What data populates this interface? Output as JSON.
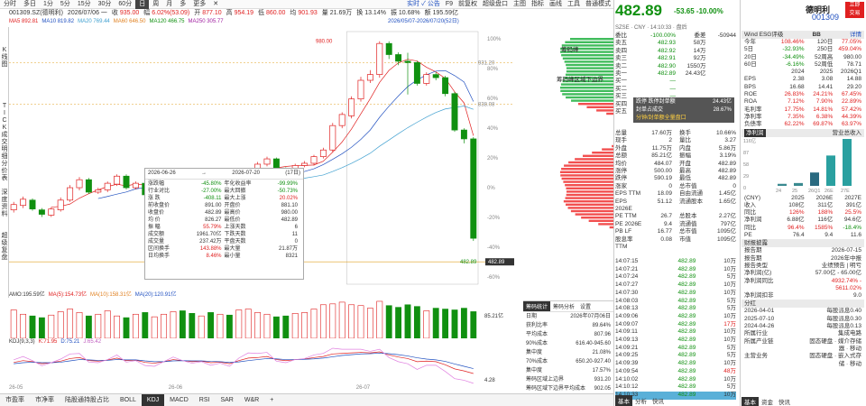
{
  "toolbar": {
    "items": [
      "分时",
      "多日",
      "1分",
      "5分",
      "15分",
      "30分",
      "60分",
      "日",
      "周",
      "月",
      "多",
      "更多",
      "✕"
    ],
    "active": 7,
    "right": [
      "实时 ✓ 公告",
      "F9",
      "前复权",
      "超级盘口",
      "主图",
      "指标",
      "画线",
      "工具",
      "",
      "普通模式"
    ]
  },
  "stock": {
    "code": "001309.SZ(德明利)",
    "date": "2026/07/06",
    "day": "一",
    "close_label": "收",
    "close": "935.00",
    "chg_label": "幅",
    "chg": "6.02%(53.09)",
    "open_label": "开",
    "open": "877.10",
    "high_label": "高",
    "high": "954.19",
    "low_label": "低",
    "low": "860.00",
    "cur_label": "均",
    "cur": "901.93",
    "vol_label": "量",
    "vol": "21.69万",
    "turn_label": "换",
    "turn": "13.14%",
    "amp_label": "振",
    "amp": "10.68%",
    "amt_label": "额",
    "amt": "195.59亿"
  },
  "ma": [
    {
      "label": "MA5",
      "value": "892.81",
      "color": "#e02020"
    },
    {
      "label": "MA10",
      "value": "819.82",
      "color": "#2050c0"
    },
    {
      "label": "MA20",
      "value": "769.44",
      "color": "#40a0d0"
    },
    {
      "label": "MA60",
      "value": "646.50",
      "color": "#e08020"
    },
    {
      "label": "MA120",
      "value": "466.75",
      "color": "#109010"
    },
    {
      "label": "MA250",
      "value": "305.77",
      "color": "#a020a0"
    }
  ],
  "date_range": "2026/05/07-2026/07/20(52日)",
  "vert_tabs": [
    {
      "text": "K\n线\n图",
      "y": 22
    },
    {
      "text": "T\nI\nC\nK\n成\n交\n明\n细",
      "y": 84
    },
    {
      "text": "分\n价\n表",
      "y": 148
    },
    {
      "text": "深\n度\n资\n料",
      "y": 180
    },
    {
      "text": "超\n级\n复\n盘",
      "y": 228
    }
  ],
  "y_labels": [
    "1012",
    "986",
    "959",
    "933",
    "906",
    "880",
    "855",
    "826",
    "800",
    "773",
    "747",
    "720",
    "693",
    "667",
    "640",
    "614",
    "587",
    "561",
    "534",
    "508",
    "481",
    "455",
    "429",
    "402"
  ],
  "pct_labels": [
    "100%",
    "80%",
    "60%",
    "40%",
    "20%",
    "0%",
    "-20%",
    "-40%",
    "-60%"
  ],
  "price_tags": {
    "top": "980.00",
    "right_top": "931.20",
    "mid": "838.08",
    "low": "482.89",
    "low2": "482.89"
  },
  "dist_labels": {
    "a": "筹码峰",
    "b": "筹码峰区域下边界"
  },
  "chart_data": [
    {
      "type": "candlestick",
      "title": "",
      "xlabel": "",
      "ylabel": "",
      "x": [
        "05-07",
        "05-08",
        "05-11",
        "05-12",
        "05-13",
        "05-14",
        "05-15",
        "05-18",
        "05-19",
        "05-20",
        "05-21",
        "05-22",
        "05-25",
        "05-26",
        "05-27",
        "05-28",
        "05-29",
        "06-01",
        "06-02",
        "06-03",
        "06-04",
        "06-05",
        "06-08",
        "06-09",
        "06-10",
        "06-11",
        "06-12",
        "06-15",
        "06-16",
        "06-17",
        "06-18",
        "06-19",
        "06-22",
        "06-23",
        "06-24",
        "06-25",
        "06-26",
        "06-29",
        "06-30",
        "07-01",
        "07-02",
        "07-03",
        "07-06",
        "07-07",
        "07-08",
        "07-09",
        "07-10",
        "07-13",
        "07-14",
        "07-15"
      ],
      "open": [
        600,
        610,
        622,
        600,
        588,
        600,
        622,
        650,
        668,
        640,
        645,
        658,
        676,
        650,
        660,
        634,
        640,
        655,
        672,
        668,
        660,
        668,
        652,
        660,
        640,
        672,
        690,
        703,
        715,
        693,
        688,
        700,
        705,
        720,
        735,
        790,
        812,
        850,
        892,
        905,
        975,
        950,
        935,
        932,
        885,
        905,
        898,
        862,
        780,
        760
      ],
      "close": [
        612,
        624,
        602,
        590,
        602,
        622,
        650,
        668,
        640,
        645,
        660,
        676,
        650,
        660,
        634,
        642,
        656,
        672,
        668,
        660,
        668,
        652,
        660,
        640,
        672,
        690,
        703,
        715,
        693,
        688,
        700,
        705,
        720,
        735,
        790,
        815,
        850,
        892,
        905,
        975,
        950,
        935,
        932,
        885,
        905,
        898,
        862,
        780,
        760,
        536
      ],
      "high": [
        618,
        630,
        626,
        604,
        606,
        628,
        656,
        674,
        672,
        650,
        664,
        680,
        680,
        664,
        664,
        648,
        660,
        676,
        676,
        672,
        672,
        670,
        664,
        662,
        676,
        694,
        708,
        720,
        718,
        696,
        704,
        710,
        724,
        740,
        796,
        820,
        856,
        900,
        915,
        980,
        980,
        955,
        954,
        936,
        910,
        910,
        902,
        866,
        784,
        764
      ],
      "low": [
        594,
        604,
        598,
        584,
        584,
        596,
        618,
        644,
        636,
        636,
        640,
        654,
        646,
        646,
        630,
        628,
        636,
        650,
        660,
        654,
        654,
        646,
        646,
        636,
        636,
        668,
        686,
        698,
        690,
        684,
        684,
        696,
        700,
        716,
        730,
        784,
        806,
        844,
        886,
        898,
        940,
        926,
        860,
        880,
        880,
        892,
        856,
        776,
        750,
        530
      ],
      "ylim": [
        402,
        1012
      ]
    },
    {
      "type": "bar",
      "title": "AMO",
      "values": [
        165,
        140,
        130,
        120,
        135,
        155,
        170,
        150,
        130,
        140,
        160,
        130,
        120,
        140,
        150,
        125,
        140,
        155,
        160,
        145,
        130,
        150,
        140,
        135,
        165,
        170,
        150,
        140,
        125,
        130,
        145,
        150,
        170,
        195,
        200,
        210,
        195,
        190,
        175,
        215,
        190,
        180,
        195,
        185,
        160,
        175,
        170,
        165,
        175,
        155
      ],
      "ylim": [
        0,
        220
      ],
      "info": [
        {
          "label": "AMO:",
          "value": "195.59亿"
        },
        {
          "label": "MA(5):",
          "value": "154.73亿"
        },
        {
          "label": "MA(10):",
          "value": "158.31亿"
        },
        {
          "label": "MA(20):",
          "value": "120.91亿"
        }
      ],
      "right": "85.21亿"
    },
    {
      "type": "line",
      "title": "KDJ(9,3,3)",
      "series": [
        {
          "name": "K",
          "color": "#e02020",
          "values": [
            55,
            62,
            58,
            50,
            54,
            60,
            70,
            74,
            62,
            60,
            64,
            72,
            62,
            64,
            55,
            52,
            58,
            66,
            62,
            58,
            60,
            54,
            56,
            50,
            62,
            72,
            74,
            78,
            66,
            62,
            66,
            68,
            74,
            78,
            88,
            90,
            92,
            94,
            92,
            96,
            84,
            76,
            70,
            58,
            60,
            58,
            46,
            30,
            22,
            12
          ]
        },
        {
          "name": "D",
          "color": "#2050c0",
          "values": [
            50,
            54,
            56,
            54,
            54,
            56,
            61,
            66,
            65,
            63,
            63,
            66,
            65,
            65,
            61,
            58,
            58,
            61,
            62,
            61,
            61,
            59,
            58,
            55,
            57,
            62,
            66,
            70,
            69,
            66,
            66,
            67,
            69,
            72,
            77,
            82,
            85,
            88,
            89,
            91,
            89,
            85,
            80,
            73,
            68,
            65,
            59,
            49,
            40,
            31
          ]
        },
        {
          "name": "J",
          "color": "#e080e0",
          "values": [
            65,
            78,
            62,
            42,
            54,
            68,
            88,
            90,
            56,
            54,
            66,
            84,
            56,
            62,
            43,
            40,
            58,
            76,
            62,
            52,
            58,
            44,
            52,
            40,
            72,
            92,
            90,
            94,
            60,
            54,
            66,
            70,
            84,
            90,
            110,
            106,
            106,
            106,
            98,
            106,
            74,
            58,
            50,
            28,
            44,
            44,
            20,
            -8,
            -14,
            -26
          ]
        }
      ],
      "ylim": [
        -30,
        110
      ],
      "info": [
        {
          "label": "KDJ(9,3,3)",
          "value": "K:",
          "vk": "71.95"
        },
        {
          "label": "D:",
          "value": "75.21"
        },
        {
          "label": "J:",
          "value": "65.42"
        }
      ],
      "right": "4.28"
    }
  ],
  "x_ticks": [
    {
      "label": "26-05",
      "pos": 0
    },
    {
      "label": "26-06",
      "pos": 17
    },
    {
      "label": "26-07",
      "pos": 37
    }
  ],
  "popup": {
    "from": "2026-06-26",
    "to": "2026-07-20",
    "days": "(17日)",
    "rows": [
      [
        "涨跌幅",
        "-45.80%",
        "年化收益率",
        "-99.99%"
      ],
      [
        "行业对比",
        "-27.00%",
        "最大回撤",
        "-50.73%"
      ],
      [
        "涨 跌",
        "-408.11",
        "最大上涨",
        "20.02%"
      ],
      [
        "前收盘价",
        "891.00",
        "开盘价",
        "881.10"
      ],
      [
        "收盘价",
        "482.89",
        "最高价",
        "980.00"
      ],
      [
        "均 价",
        "826.27",
        "最低价",
        "482.89"
      ],
      [
        "振 幅",
        "55.79%",
        "上涨天数",
        "6"
      ],
      [
        "成交额",
        "1961.70亿",
        "下跌天数",
        "11"
      ],
      [
        "成交量",
        "237.42万",
        "平盘天数",
        "0"
      ],
      [
        "区间换手",
        "143.88%",
        "最大量",
        "21.87万"
      ],
      [
        "日均换手",
        "8.46%",
        "最小量",
        "8321"
      ]
    ]
  },
  "chips": {
    "tabs": [
      "筹码统计",
      "筹码分析",
      "设置"
    ],
    "rows": [
      [
        "日期",
        "2026年07月06日"
      ],
      [
        "获利比率",
        "89.64%"
      ],
      [
        "平均成本",
        "807.96"
      ],
      [
        "90%成本",
        "616.40-945.60"
      ],
      [
        "集中度",
        "21.08%"
      ],
      [
        "70%成本",
        "650.20-927.40"
      ],
      [
        "集中度",
        "17.57%"
      ],
      [
        "筹码区域上边界",
        "931.20"
      ],
      [
        "筹码区域下边界平均成本",
        "902.05"
      ]
    ]
  },
  "bottom_tabs": [
    "市盈率",
    "市净率",
    "陆股通持股占比",
    "BOLL",
    "KDJ",
    "MACD",
    "RSI",
    "SAR",
    "W&R",
    "+"
  ],
  "bottom_active": 4,
  "quote": {
    "price": "482.89",
    "chg": "-53.65",
    "pct": "-10.00%",
    "code_line": "SZSE · CNY · 14:10:33 · 盘后",
    "name": "德明利",
    "code": "001309",
    "btn": "立即\n交易"
  },
  "orderbook": [
    [
      "委比",
      "-100.00%",
      "委差",
      "-50944"
    ],
    [
      "卖五",
      "482.93",
      "58万",
      ""
    ],
    [
      "卖四",
      "482.92",
      "14万",
      ""
    ],
    [
      "卖三",
      "482.91",
      "92万",
      ""
    ],
    [
      "卖二",
      "482.90",
      "1550万",
      ""
    ],
    [
      "卖一",
      "482.89",
      "24.43亿",
      ""
    ],
    [
      "买一",
      "—",
      "",
      ""
    ],
    [
      "买二",
      "—",
      "",
      ""
    ],
    [
      "买三",
      "—",
      "",
      ""
    ],
    [
      "买四",
      "—",
      "",
      ""
    ],
    [
      "买五",
      "—",
      "",
      ""
    ]
  ],
  "seal": {
    "l1": "跌停 跌停封单额",
    "v1": "24.43亿",
    "l2": "封单占成交",
    "v2": "28.67%",
    "l3": "分钟/封单额全量盘口"
  },
  "stats": [
    [
      "总量",
      "17.60万",
      "换手",
      "10.66%"
    ],
    [
      "现手",
      "2",
      "量比",
      "3.27"
    ],
    [
      "外盘",
      "11.75万",
      "内盘",
      "5.86万"
    ],
    [
      "总额",
      "85.21亿",
      "振幅",
      "3.19%"
    ],
    [
      "均价",
      "484.07",
      "开盘",
      "482.89"
    ],
    [
      "涨停",
      "500.00",
      "最高",
      "482.89"
    ],
    [
      "跌停",
      "590.19",
      "最低",
      "482.89"
    ],
    [
      "涨家",
      "0",
      "总市值",
      "0"
    ],
    [
      "EPS TTM",
      "18.09",
      "自由流通",
      "1.45亿"
    ],
    [
      "EPS 2026E",
      "51.12",
      "流通股本",
      "1.65亿"
    ],
    [
      "PE TTM",
      "26.7",
      "总股本",
      "2.27亿"
    ],
    [
      "PE 2026E",
      "9.4",
      "流通值",
      "797亿"
    ],
    [
      "PB LF",
      "16.77",
      "总市值",
      "1095亿"
    ],
    [
      "股息率 TTM",
      "0.08",
      "市值",
      "1095亿"
    ]
  ],
  "ticks": [
    [
      "14:07:15",
      "482.89",
      "10万"
    ],
    [
      "14:07:21",
      "482.89",
      "10万"
    ],
    [
      "14:07:24",
      "482.89",
      "5万"
    ],
    [
      "14:07:27",
      "482.89",
      "10万"
    ],
    [
      "14:07:30",
      "482.89",
      "10万"
    ],
    [
      "14:08:03",
      "482.89",
      "5万"
    ],
    [
      "14:08:13",
      "482.89",
      "5万"
    ],
    [
      "14:09:06",
      "482.89",
      "10万"
    ],
    [
      "14:09:07",
      "482.89",
      "17万"
    ],
    [
      "14:09:11",
      "482.89",
      "10万"
    ],
    [
      "14:09:13",
      "482.89",
      "10万"
    ],
    [
      "14:09:21",
      "482.89",
      "5万"
    ],
    [
      "14:09:25",
      "482.89",
      "5万"
    ],
    [
      "14:09:39",
      "482.89",
      "10万"
    ],
    [
      "14:09:54",
      "482.89",
      "48万"
    ],
    [
      "14:10:02",
      "482.89",
      "10万"
    ],
    [
      "14:10:12",
      "482.89",
      "5万"
    ],
    [
      "14:10:33",
      "482.89",
      "10万"
    ]
  ],
  "right_tabs": [
    "基本",
    "分析",
    "快讯"
  ],
  "fin": {
    "tab": "Wind ESG评级",
    "rating": "BB",
    "more": "详情",
    "perf": [
      [
        "今年",
        "108.46%",
        "120日",
        "77.05%"
      ],
      [
        "5日",
        "-32.93%",
        "250日",
        "459.04%"
      ],
      [
        "20日",
        "-34.49%",
        "52周高",
        "980.00"
      ],
      [
        "60日",
        "-6.16%",
        "52周低",
        "78.71"
      ]
    ],
    "hdr": [
      "",
      "2024",
      "2025",
      "2026Q1"
    ],
    "rows": [
      [
        "EPS",
        "2.38",
        "3.08",
        "14.88"
      ],
      [
        "BPS",
        "16.68",
        "14.41",
        "29.20"
      ],
      [
        "ROE",
        "26.83%",
        "24.21%",
        "67.45%"
      ],
      [
        "ROA",
        "7.12%",
        "7.90%",
        "22.89%"
      ],
      [
        "毛利率",
        "17.75%",
        "14.81%",
        "57.42%"
      ],
      [
        "净利率",
        "7.35%",
        "6.38%",
        "44.39%"
      ],
      [
        "负债率",
        "62.22%",
        "69.87%",
        "63.97%"
      ]
    ],
    "tabs2": [
      "净利润",
      "营业总收入"
    ],
    "bar_y": [
      "116亿",
      "87",
      "58",
      "29",
      "0"
    ],
    "bar_x": [
      "24",
      "25",
      "26Q1",
      "26E",
      "27E"
    ],
    "bars": [
      5,
      7,
      33,
      75,
      116
    ],
    "fc_hdr": [
      "(CNY)",
      "2025",
      "2026E",
      "2027E"
    ],
    "fc": [
      [
        "收入",
        "108亿",
        "311亿",
        "391亿"
      ],
      [
        "同比",
        "126%",
        "188%",
        "25.5%"
      ],
      [
        "净利润",
        "6.88亿",
        "116亿",
        "94.6亿"
      ],
      [
        "同比",
        "96.4%",
        "1585%",
        "-18.4%"
      ],
      [
        "PE",
        "76.4",
        "9.4",
        "11.6"
      ]
    ],
    "rpt_title": "财报披露",
    "rpt": [
      [
        "报告期",
        "2026-07-15"
      ],
      [
        "报告期",
        "2026年中报"
      ],
      [
        "报告类型",
        "业绩预告 | 明亏"
      ],
      [
        "净利润(亿)",
        "57.00亿 - 65.00亿"
      ],
      [
        "净利润同比",
        "4932.74% - 5611.02%"
      ],
      [
        "净利润扣非",
        "9.0"
      ]
    ],
    "div_title": "分红",
    "div": [
      [
        "2026-04-01",
        "每股派息0.40"
      ],
      [
        "2025-07-10",
        "每股派息0.30"
      ],
      [
        "2024-04-26",
        "每股派息0.13"
      ]
    ],
    "ind": [
      [
        "所属行业",
        "集成电路"
      ],
      [
        "所属产业链",
        "固态硬盘 · 媒介存储器 · 移动"
      ],
      [
        "主营业务",
        "固态硬盘 · 嵌入式存储 · 移动"
      ]
    ],
    "btm_tabs": [
      "基本",
      "资金",
      "快讯"
    ]
  }
}
